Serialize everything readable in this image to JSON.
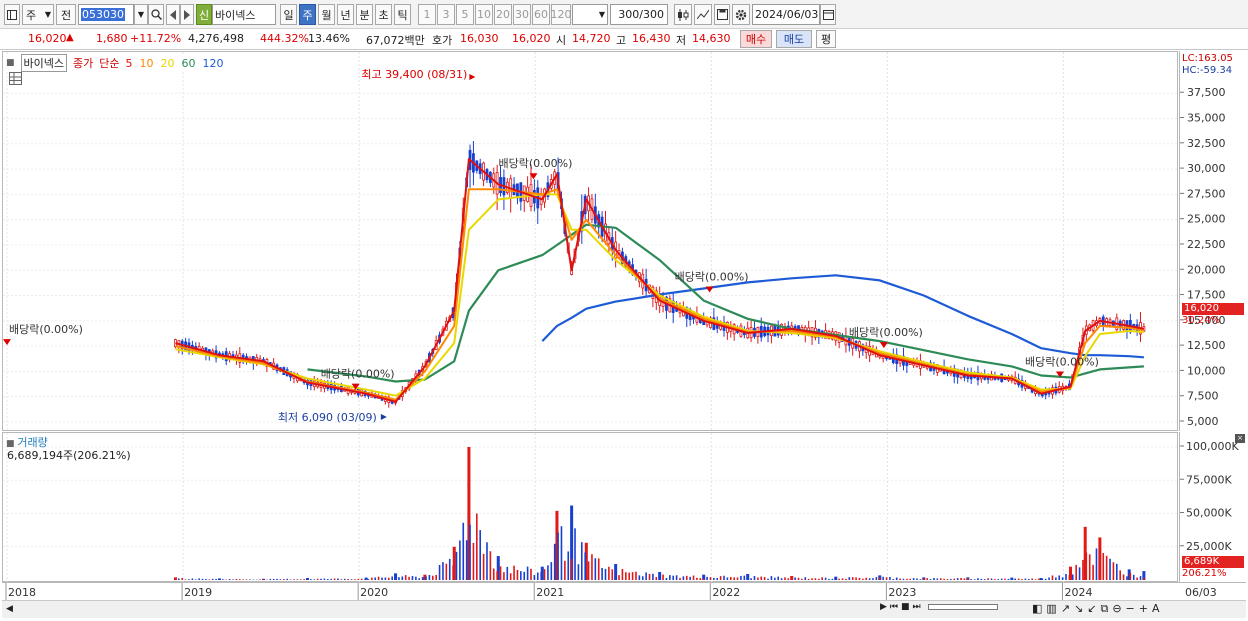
{
  "toolbar": {
    "period_sel": "주",
    "prev_label": "전",
    "code": "053030",
    "credit_tag": "신",
    "name": "바이넥스",
    "periods": [
      "일",
      "주",
      "월",
      "년",
      "분",
      "초",
      "틱"
    ],
    "active_period": "주",
    "intervals": [
      "1",
      "3",
      "5",
      "10",
      "20",
      "30",
      "60",
      "120"
    ],
    "count": "300/300",
    "date": "2024/06/03"
  },
  "quote": {
    "price": "16,020",
    "arrow": "▲",
    "change": "1,680",
    "change_pct": "+11.72%",
    "volume": "4,276,498",
    "vol_ratio": "444.32%",
    "turnover": "13.46%",
    "amount": "67,072백만",
    "hoga_label": "호가",
    "bid": "16,030",
    "ask": "16,020",
    "open_label": "시",
    "open": "14,720",
    "high_label": "고",
    "high": "16,430",
    "low_label": "저",
    "low": "14,630",
    "buy": "매수",
    "sell": "매도",
    "avg": "평"
  },
  "legend": {
    "name": "바이넥스",
    "close": "종가",
    "simple": "단순",
    "ma": [
      {
        "label": "5",
        "color": "#dd1111"
      },
      {
        "label": "10",
        "color": "#ff8a00"
      },
      {
        "label": "20",
        "color": "#e8d800"
      },
      {
        "label": "60",
        "color": "#2e8b57"
      },
      {
        "label": "120",
        "color": "#1e5bd6"
      }
    ]
  },
  "axis_info": {
    "lc": "LC:163.05",
    "hc": "HC:-59.34"
  },
  "annotations": {
    "high": "최고 39,400 (08/31)",
    "low": "최저 6,090 (03/09)",
    "dividends": [
      "배당락(0.00%)",
      "배당락(0.00%)",
      "배당락(0.00%)",
      "배당락(0.00%)",
      "배당락(0.00%)",
      "배당락(0.00%)"
    ]
  },
  "price_tag": {
    "value": "16,020",
    "pct": "30.24%"
  },
  "volume": {
    "title": "거래량",
    "value": "6,689,194주(206.21%)",
    "tag_value": "6,689K",
    "tag_pct": "206.21%"
  },
  "x_labels": [
    "2018",
    "2019",
    "2020",
    "2021",
    "2022",
    "2023",
    "2024",
    "06/03"
  ],
  "chart_data": {
    "type": "line",
    "title": "",
    "xlabel": "",
    "ylabel": "",
    "price_ylim": [
      5000,
      39400
    ],
    "price_ticks": [
      "37,500",
      "35,000",
      "32,500",
      "30,000",
      "27,500",
      "25,000",
      "22,500",
      "20,000",
      "17,500",
      "15,000",
      "12,500",
      "10,000",
      "7,500",
      "5,000"
    ],
    "volume_ticks": [
      "100,000K",
      "75,000K",
      "50,000K",
      "25,000K"
    ],
    "volume_ylim": [
      0,
      100000
    ],
    "x": [
      "2018-12",
      "2019-03",
      "2019-06",
      "2019-09",
      "2020-01",
      "2020-03",
      "2020-05",
      "2020-07",
      "2020-08",
      "2020-10",
      "2021-01",
      "2021-02",
      "2021-03",
      "2021-04",
      "2021-06",
      "2021-09",
      "2021-12",
      "2022-03",
      "2022-06",
      "2022-09",
      "2022-12",
      "2023-03",
      "2023-06",
      "2023-09",
      "2023-11",
      "2024-01",
      "2024-02",
      "2024-03",
      "2024-05",
      "2024-06"
    ],
    "series": [
      {
        "name": "5",
        "values": [
          12800,
          11600,
          11000,
          8900,
          7800,
          7000,
          10500,
          16000,
          31000,
          28500,
          27000,
          29500,
          20000,
          27000,
          22000,
          17000,
          15000,
          13800,
          14200,
          13500,
          11600,
          10600,
          9600,
          9300,
          7800,
          8500,
          14000,
          15000,
          14500,
          14200
        ]
      },
      {
        "name": "10",
        "values": [
          12500,
          11500,
          10800,
          9000,
          7900,
          7200,
          10000,
          14500,
          28000,
          28000,
          27500,
          28000,
          23000,
          25000,
          21500,
          17200,
          15200,
          13900,
          14000,
          13400,
          11800,
          10700,
          9700,
          9300,
          8000,
          8400,
          12800,
          14500,
          14300,
          14100
        ]
      },
      {
        "name": "20",
        "values": [
          12200,
          11400,
          10700,
          9300,
          8200,
          7600,
          9300,
          12800,
          24000,
          27000,
          27500,
          27500,
          24000,
          24000,
          21000,
          17500,
          15400,
          14000,
          13800,
          13300,
          12000,
          10900,
          9900,
          9400,
          8200,
          8300,
          11500,
          13700,
          14000,
          13900
        ]
      },
      {
        "name": "60",
        "values": [
          null,
          null,
          null,
          10200,
          9500,
          9000,
          9200,
          11000,
          16000,
          20000,
          21500,
          22500,
          23500,
          24500,
          24200,
          21000,
          17000,
          15200,
          14200,
          13600,
          13000,
          12100,
          11200,
          10500,
          9600,
          9400,
          9800,
          10200,
          10400,
          10500
        ]
      },
      {
        "name": "120",
        "values": [
          null,
          null,
          null,
          null,
          null,
          null,
          null,
          null,
          null,
          null,
          13000,
          14500,
          15300,
          16200,
          16900,
          17600,
          18200,
          18800,
          19200,
          19500,
          19000,
          17500,
          15500,
          13700,
          12300,
          11800,
          11600,
          11600,
          11500,
          11400
        ]
      }
    ],
    "volume_values": [
      2000,
      1200,
      900,
      1500,
      1800,
      5000,
      4000,
      25000,
      100000,
      18000,
      10000,
      52000,
      56000,
      28000,
      12000,
      6000,
      4000,
      4500,
      3000,
      2500,
      3500,
      2000,
      2000,
      1800,
      1500,
      10000,
      40000,
      32000,
      8000,
      6700
    ]
  }
}
